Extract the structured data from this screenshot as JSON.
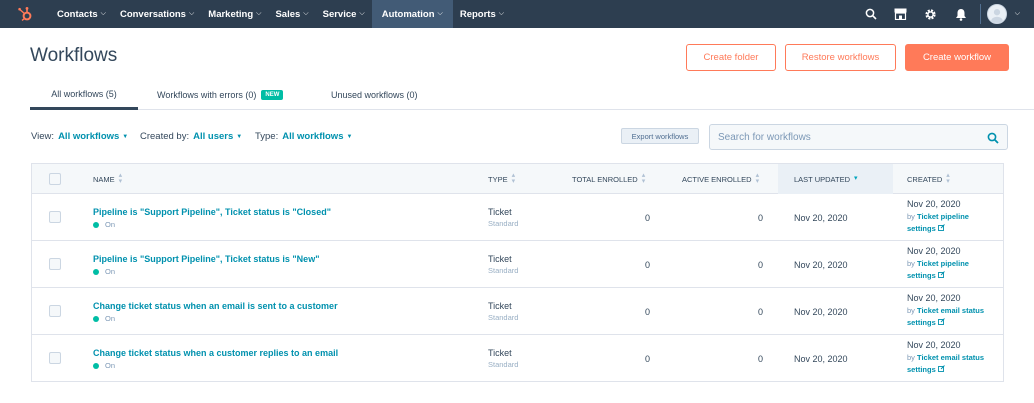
{
  "nav": {
    "items": [
      {
        "label": "Contacts"
      },
      {
        "label": "Conversations"
      },
      {
        "label": "Marketing"
      },
      {
        "label": "Sales"
      },
      {
        "label": "Service"
      },
      {
        "label": "Automation"
      },
      {
        "label": "Reports"
      }
    ],
    "active": "Automation"
  },
  "header": {
    "title": "Workflows",
    "create_folder": "Create folder",
    "restore": "Restore workflows",
    "create_workflow": "Create workflow"
  },
  "tabs": [
    {
      "label": "All workflows (5)"
    },
    {
      "label": "Workflows with errors (0)",
      "badge": "NEW"
    },
    {
      "label": "Unused workflows (0)"
    }
  ],
  "filters": {
    "view_label": "View:",
    "view_value": "All workflows",
    "created_label": "Created by:",
    "created_value": "All users",
    "type_label": "Type:",
    "type_value": "All workflows",
    "export": "Export workflows",
    "search_placeholder": "Search for workflows"
  },
  "table": {
    "headers": {
      "name": "NAME",
      "type": "TYPE",
      "total": "TOTAL ENROLLED",
      "active": "ACTIVE ENROLLED",
      "updated": "LAST UPDATED",
      "created": "CREATED"
    },
    "rows": [
      {
        "name": "Pipeline is \"Support Pipeline\", Ticket status is \"Closed\"",
        "status": "On",
        "type": "Ticket",
        "subtype": "Standard",
        "total": "0",
        "active": "0",
        "updated": "Nov 20, 2020",
        "created": "Nov 20, 2020",
        "by": "by",
        "creator_line1": "Ticket pipeline",
        "creator_line2": "settings"
      },
      {
        "name": "Pipeline is \"Support Pipeline\", Ticket status is \"New\"",
        "status": "On",
        "type": "Ticket",
        "subtype": "Standard",
        "total": "0",
        "active": "0",
        "updated": "Nov 20, 2020",
        "created": "Nov 20, 2020",
        "by": "by",
        "creator_line1": "Ticket pipeline",
        "creator_line2": "settings"
      },
      {
        "name": "Change ticket status when an email is sent to a customer",
        "status": "On",
        "type": "Ticket",
        "subtype": "Standard",
        "total": "0",
        "active": "0",
        "updated": "Nov 20, 2020",
        "created": "Nov 20, 2020",
        "by": "by",
        "creator_line1": "Ticket email status",
        "creator_line2": "settings"
      },
      {
        "name": "Change ticket status when a customer replies to an email",
        "status": "On",
        "type": "Ticket",
        "subtype": "Standard",
        "total": "0",
        "active": "0",
        "updated": "Nov 20, 2020",
        "created": "Nov 20, 2020",
        "by": "by",
        "creator_line1": "Ticket email status",
        "creator_line2": "settings"
      }
    ]
  },
  "colors": {
    "nav_bg": "#2d3e50",
    "accent": "#ff7a59",
    "link": "#0091ae",
    "status_on": "#00bda5"
  },
  "icons": [
    "hubspot-logo-icon",
    "search-icon",
    "marketplace-icon",
    "settings-gear-icon",
    "notifications-bell-icon",
    "avatar-icon",
    "external-link-icon",
    "sort-icon",
    "checkbox-icon"
  ]
}
